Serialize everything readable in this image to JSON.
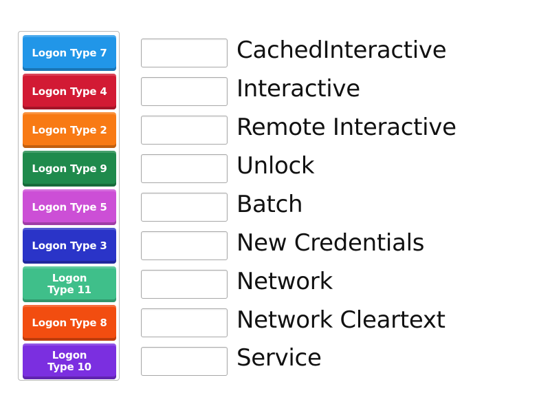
{
  "tiles": [
    {
      "label": "Logon Type 7",
      "color": "#2196e8"
    },
    {
      "label": "Logon Type 4",
      "color": "#d21a34"
    },
    {
      "label": "Logon Type 2",
      "color": "#f87a14"
    },
    {
      "label": "Logon Type 9",
      "color": "#1f8a4c"
    },
    {
      "label": "Logon Type 5",
      "color": "#cc4fd6"
    },
    {
      "label": "Logon Type 3",
      "color": "#2a34c8"
    },
    {
      "label": "Logon Type 11",
      "color": "#3fbf8a"
    },
    {
      "label": "Logon Type 8",
      "color": "#f24d10"
    },
    {
      "label": "Logon Type 10",
      "color": "#7b2fe0"
    }
  ],
  "targets": [
    {
      "label": "CachedInteractive",
      "value": ""
    },
    {
      "label": "Interactive",
      "value": ""
    },
    {
      "label": "Remote Interactive",
      "value": ""
    },
    {
      "label": "Unlock",
      "value": ""
    },
    {
      "label": "Batch",
      "value": ""
    },
    {
      "label": "New Credentials",
      "value": ""
    },
    {
      "label": "Network",
      "value": ""
    },
    {
      "label": "Network Cleartext",
      "value": ""
    },
    {
      "label": "Service",
      "value": ""
    }
  ]
}
